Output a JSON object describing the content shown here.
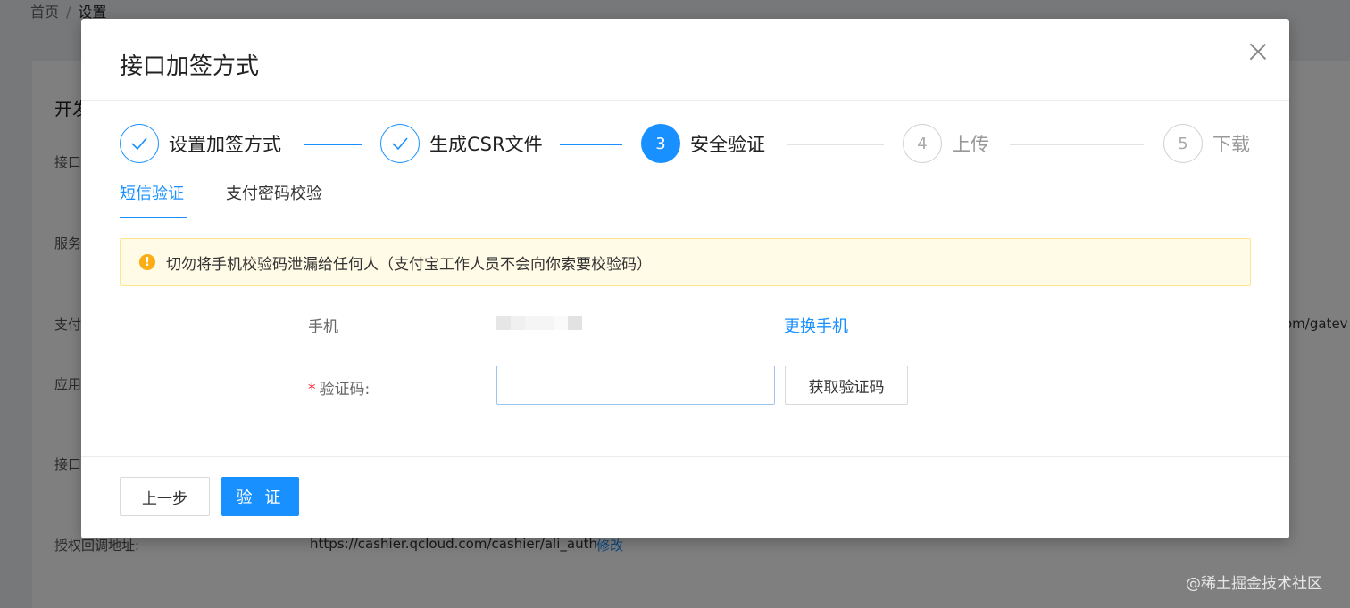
{
  "background": {
    "breadcrumb": [
      "首页",
      "/",
      "设置"
    ],
    "section_title": "开发",
    "labels": [
      "接口",
      "服务",
      "支付",
      "应用",
      "接口"
    ],
    "auth_callback_label": "授权回调地址:",
    "auth_callback_url": "https://cashier.qcloud.com/cashier/ali_auth",
    "auth_callback_edit": "修改",
    "right_clip_text": "om/gatev",
    "watermark": "@稀土掘金技术社区"
  },
  "modal": {
    "title": "接口加签方式",
    "steps": [
      {
        "index": "1",
        "label": "设置加签方式",
        "status": "done",
        "icon": "check-icon"
      },
      {
        "index": "2",
        "label": "生成CSR文件",
        "status": "done",
        "icon": "check-icon"
      },
      {
        "index": "3",
        "label": "安全验证",
        "status": "active"
      },
      {
        "index": "4",
        "label": "上传",
        "status": "wait"
      },
      {
        "index": "5",
        "label": "下载",
        "status": "wait"
      }
    ],
    "tabs": [
      {
        "label": "短信验证",
        "active": true
      },
      {
        "label": "支付密码校验",
        "active": false
      }
    ],
    "alert": {
      "icon": "warning-icon",
      "text": "切勿将手机校验码泄漏给任何人（支付宝工作人员不会向你索要校验码）",
      "color": "#faad14"
    },
    "form": {
      "phone_label": "手机",
      "change_phone": "更换手机",
      "code_required_mark": "*",
      "code_label": "验证码:",
      "code_value": "",
      "code_placeholder": "",
      "get_code_button": "获取验证码"
    },
    "footer": {
      "prev_button": "上一步",
      "verify_button": "验 证"
    }
  },
  "colors": {
    "primary": "#1890ff",
    "warning": "#faad14",
    "required": "#f5222d"
  }
}
